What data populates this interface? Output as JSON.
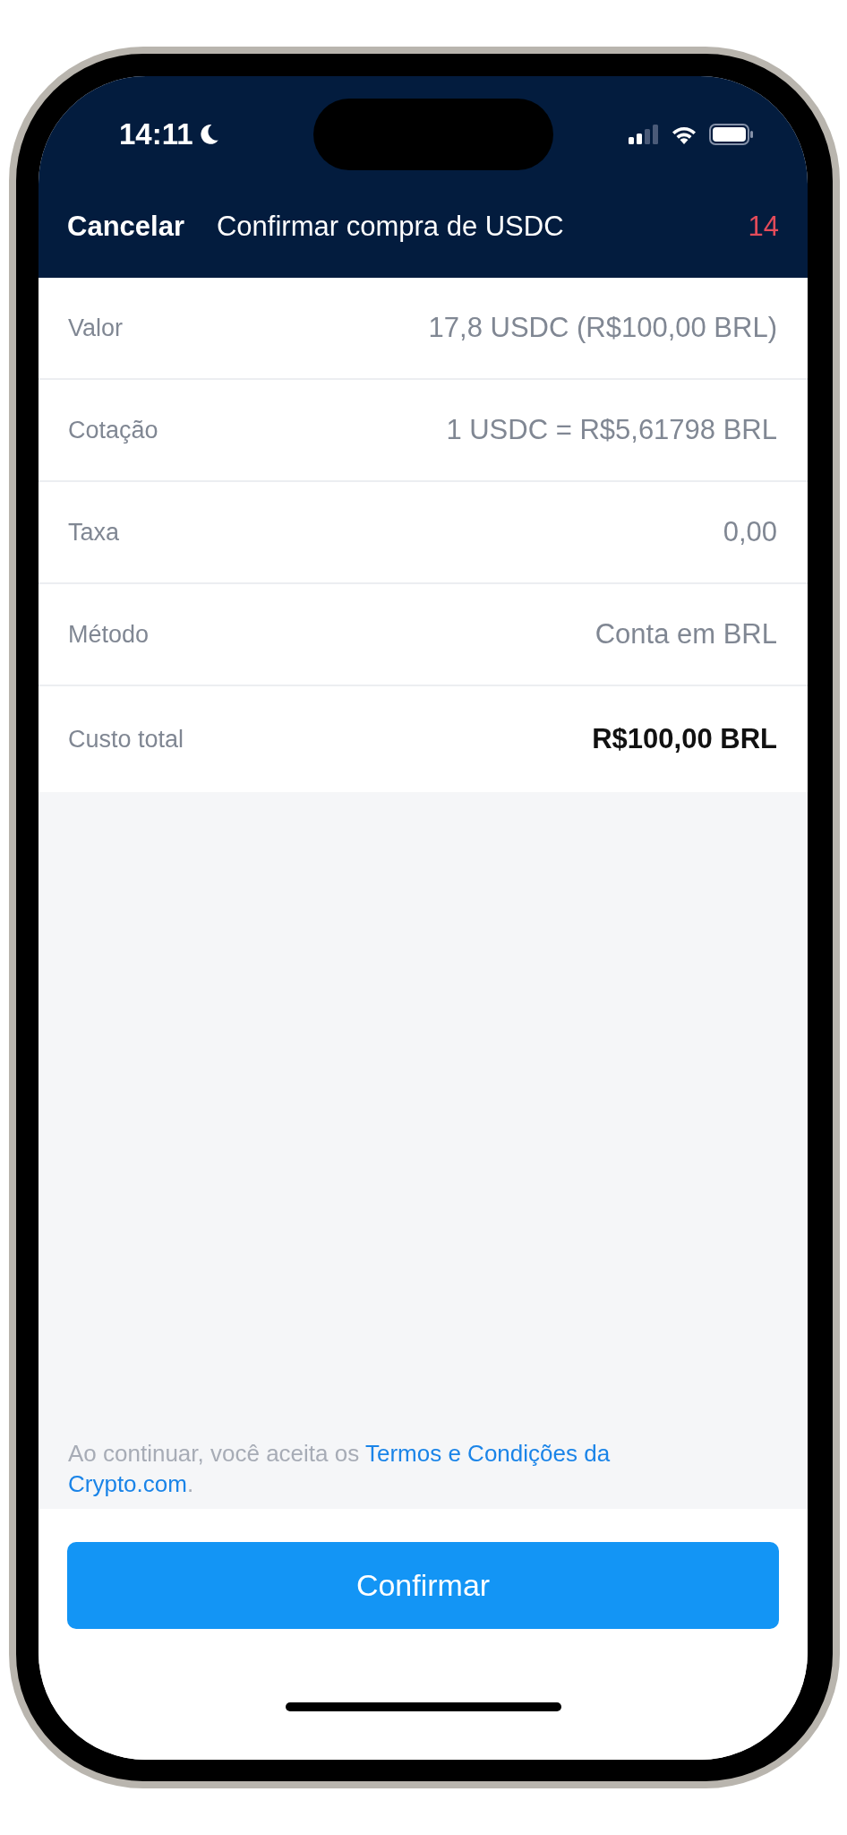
{
  "status_bar": {
    "time": "14:11"
  },
  "header": {
    "cancel": "Cancelar",
    "title": "Confirmar compra de USDC",
    "countdown": "14"
  },
  "rows": [
    {
      "label": "Valor",
      "value": "17,8 USDC (R$100,00 BRL)",
      "emphasis": false
    },
    {
      "label": "Cotação",
      "value": "1 USDC = R$5,61798 BRL",
      "emphasis": false
    },
    {
      "label": "Taxa",
      "value": "0,00",
      "emphasis": false
    },
    {
      "label": "Método",
      "value": "Conta em BRL",
      "emphasis": false
    },
    {
      "label": "Custo total",
      "value": "R$100,00 BRL",
      "emphasis": true
    }
  ],
  "terms": {
    "text": "Ao continuar, você aceita os",
    "link_lines": [
      "Termos e Condições da",
      "Crypto.com"
    ],
    "end": "."
  },
  "confirm_button": "Confirmar"
}
